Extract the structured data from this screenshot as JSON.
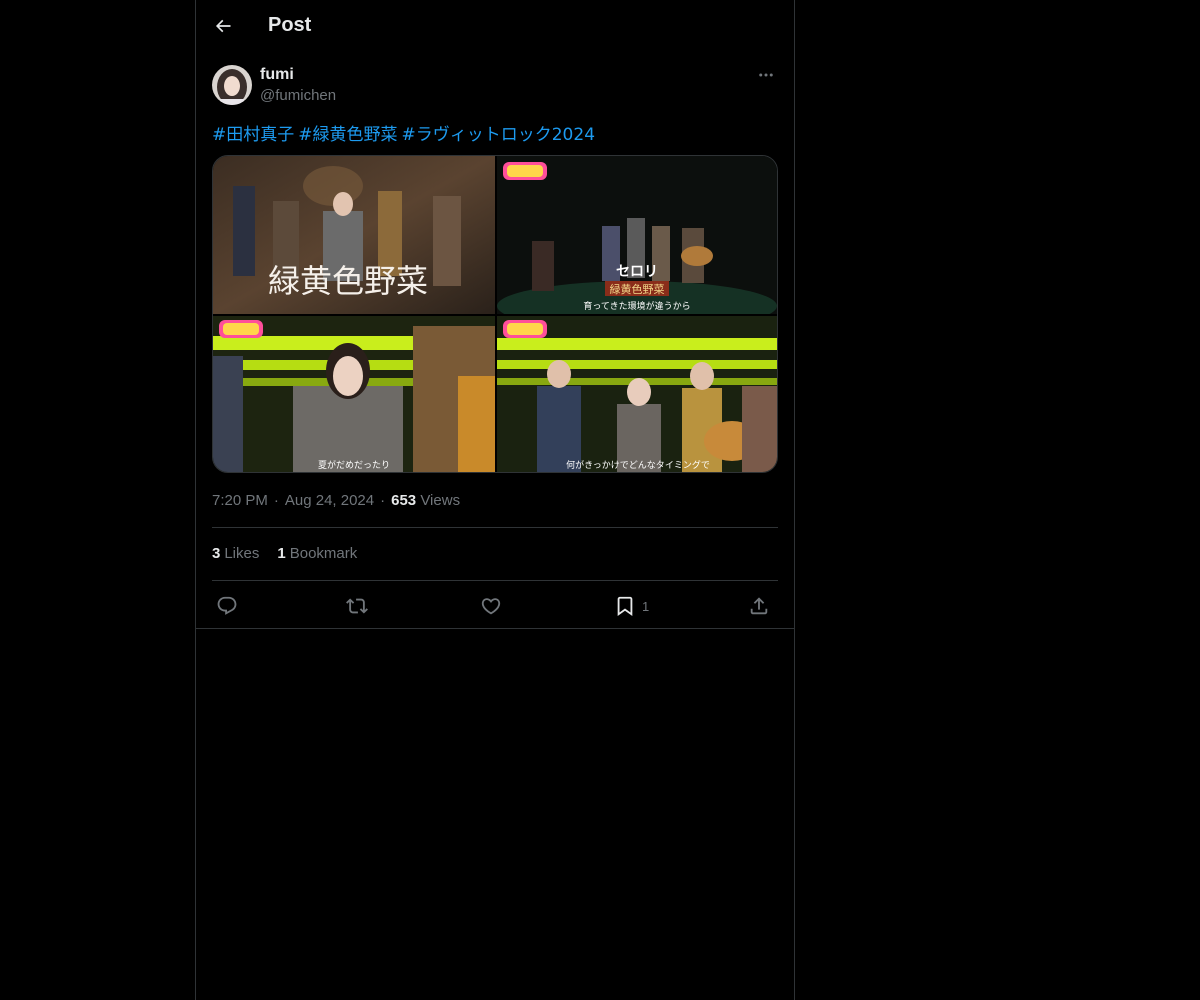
{
  "header": {
    "title": "Post",
    "back_icon": "arrow-left-icon"
  },
  "author": {
    "display_name": "fumi",
    "handle": "@fumichen"
  },
  "tweet": {
    "hashtags": [
      "#田村真子",
      "#緑黄色野菜",
      "#ラヴィットロック2024"
    ],
    "media": [
      {
        "overlay_text": "緑黄色野菜"
      },
      {
        "overlay_text": "セロリ",
        "overlay_sub": "緑黄色野菜",
        "caption": "育ってきた環境が違うから"
      },
      {
        "caption": "夏がだめだったり"
      },
      {
        "caption": "何がきっかけでどんなタイミングで"
      }
    ]
  },
  "meta": {
    "time": "7:20 PM",
    "date": "Aug 24, 2024",
    "views_count": "653",
    "views_label": "Views"
  },
  "stats": {
    "likes_count": "3",
    "likes_label": "Likes",
    "bookmarks_count": "1",
    "bookmarks_label": "Bookmark"
  },
  "actions": {
    "bookmark_count": "1"
  },
  "colors": {
    "background": "#000000",
    "text": "#e7e9ea",
    "secondary_text": "#71767b",
    "link": "#1d9bf0",
    "border": "#2f3336"
  }
}
